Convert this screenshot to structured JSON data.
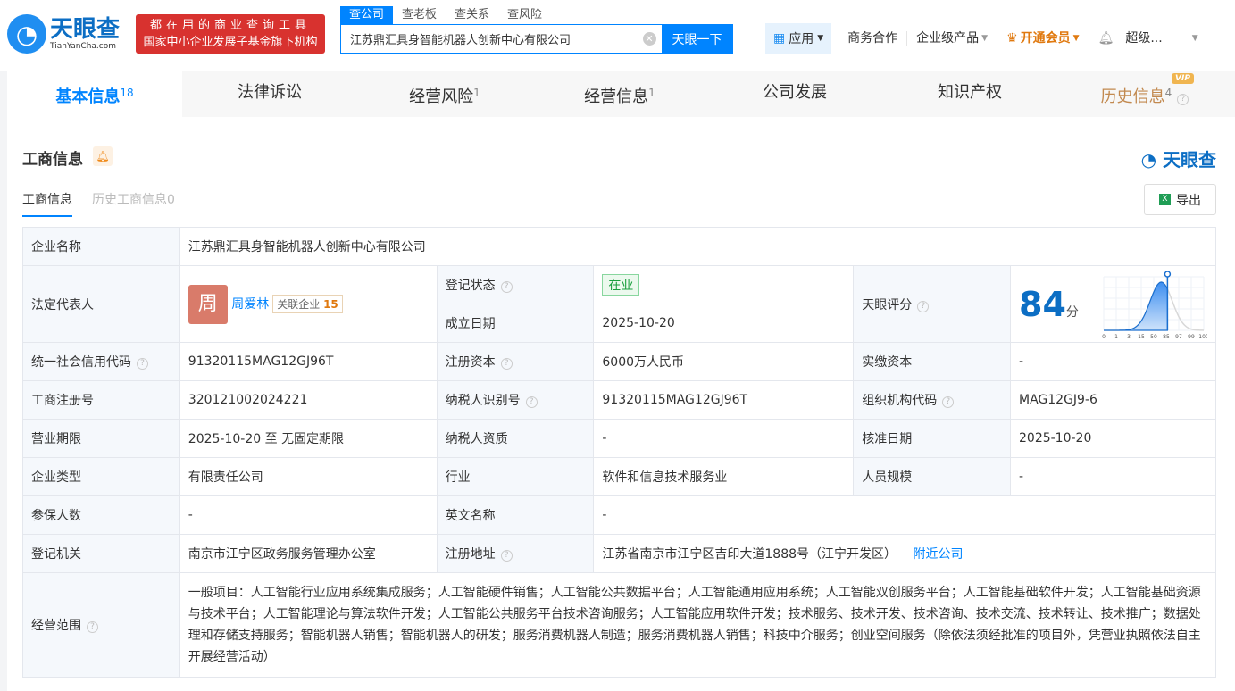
{
  "header": {
    "logo_text": "天眼查",
    "logo_domain": "TianYanCha.com",
    "slogan_line1": "都在用的商业查询工具",
    "slogan_line2": "国家中小企业发展子基金旗下机构",
    "search_tabs": [
      "查公司",
      "查老板",
      "查关系",
      "查风险"
    ],
    "search_value": "江苏鼎汇具身智能机器人创新中心有限公司",
    "search_button": "天眼一下",
    "nav": {
      "app": "应用",
      "biz": "商务合作",
      "enterprise": "企业级产品",
      "vip": "开通会员",
      "user": "超级..."
    }
  },
  "tabs": [
    {
      "label": "基本信息",
      "count": "18"
    },
    {
      "label": "法律诉讼",
      "count": ""
    },
    {
      "label": "经营风险",
      "count": "1"
    },
    {
      "label": "经营信息",
      "count": "1"
    },
    {
      "label": "公司发展",
      "count": ""
    },
    {
      "label": "知识产权",
      "count": ""
    },
    {
      "label": "历史信息",
      "count": "4",
      "badge": "VIP"
    }
  ],
  "section": {
    "title": "工商信息",
    "brand": "天眼查",
    "subtabs": [
      "工商信息",
      "历史工商信息0"
    ],
    "export": "导出"
  },
  "info": {
    "name_l": "企业名称",
    "name": "江苏鼎汇具身智能机器人创新中心有限公司",
    "legal_l": "法定代表人",
    "legal_avatar": "周",
    "legal": "周爱林",
    "related_l": "关联企业",
    "related_n": "15",
    "status_l": "登记状态",
    "status": "在业",
    "found_l": "成立日期",
    "found": "2025-10-20",
    "score_l": "天眼评分",
    "score": "84",
    "score_unit": "分",
    "score_ticks": [
      "0",
      "1",
      "3",
      "15",
      "50",
      "85",
      "97",
      "99",
      "100"
    ],
    "credit_l": "统一社会信用代码",
    "credit": "91320115MAG12GJ96T",
    "capital_l": "注册资本",
    "capital": "6000万人民币",
    "paid_l": "实缴资本",
    "paid": "-",
    "reg_l": "工商注册号",
    "reg": "320121002024221",
    "tax_l": "纳税人识别号",
    "tax": "91320115MAG12GJ96T",
    "org_l": "组织机构代码",
    "org": "MAG12GJ9-6",
    "term_l": "营业期限",
    "term": "2025-10-20 至 无固定期限",
    "taxq_l": "纳税人资质",
    "taxq": "-",
    "appr_l": "核准日期",
    "appr": "2025-10-20",
    "type_l": "企业类型",
    "type": "有限责任公司",
    "ind_l": "行业",
    "ind": "软件和信息技术服务业",
    "staff_l": "人员规模",
    "staff": "-",
    "ins_l": "参保人数",
    "ins": "-",
    "en_l": "英文名称",
    "en": "-",
    "auth_l": "登记机关",
    "auth": "南京市江宁区政务服务管理办公室",
    "addr_l": "注册地址",
    "addr": "江苏省南京市江宁区吉印大道1888号（江宁开发区）",
    "nearby": "附近公司",
    "scope_l": "经营范围",
    "scope": "一般项目：人工智能行业应用系统集成服务；人工智能硬件销售；人工智能公共数据平台；人工智能通用应用系统；人工智能双创服务平台；人工智能基础软件开发；人工智能基础资源与技术平台；人工智能理论与算法软件开发；人工智能公共服务平台技术咨询服务；人工智能应用软件开发；技术服务、技术开发、技术咨询、技术交流、技术转让、技术推广；数据处理和存储支持服务；智能机器人销售；智能机器人的研发；服务消费机器人制造；服务消费机器人销售；科技中介服务；创业空间服务（除依法须经批准的项目外，凭营业执照依法自主开展经营活动）"
  }
}
